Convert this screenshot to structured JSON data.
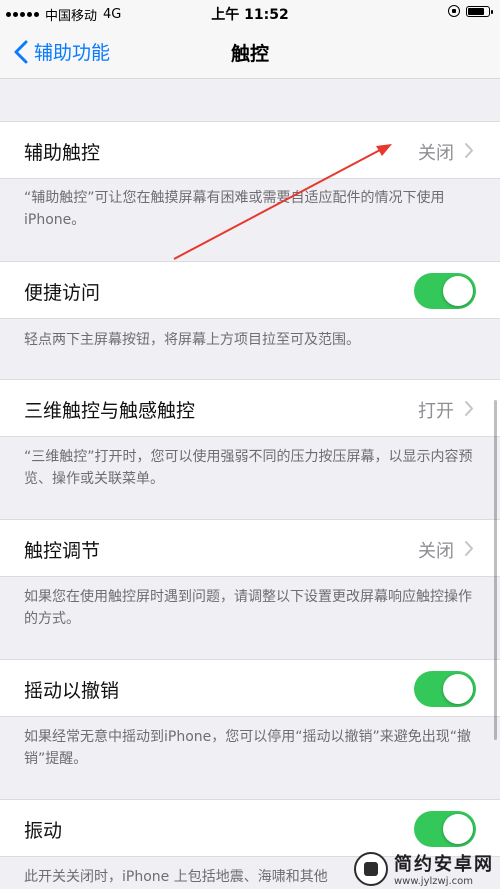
{
  "status_bar": {
    "carrier": "中国移动",
    "network": "4G",
    "time": "上午 11:52"
  },
  "nav": {
    "back_label": "辅助功能",
    "title": "触控"
  },
  "rows": [
    {
      "label": "辅助触控",
      "value": "关闭",
      "type": "disclosure"
    },
    {
      "label": "便捷访问",
      "type": "toggle",
      "on": true
    },
    {
      "label": "三维触控与触感触控",
      "value": "打开",
      "type": "disclosure"
    },
    {
      "label": "触控调节",
      "value": "关闭",
      "type": "disclosure"
    },
    {
      "label": "摇动以撤销",
      "type": "toggle",
      "on": true
    },
    {
      "label": "振动",
      "type": "toggle",
      "on": true
    }
  ],
  "footers": [
    "“辅助触控”可让您在触摸屏幕有困难或需要自适应配件的情况下使用 iPhone。",
    "轻点两下主屏幕按钮，将屏幕上方项目拉至可及范围。",
    "“三维触控”打开时，您可以使用强弱不同的压力按压屏幕，以显示内容预览、操作或关联菜单。",
    "如果您在使用触控屏时遇到问题，请调整以下设置更改屏幕响应触控操作的方式。",
    "如果经常无意中摇动到iPhone，您可以停用“摇动以撤销”来避免出现“撤销”提醒。",
    "此开关关闭时，iPhone 上包括地震、海啸和其他"
  ],
  "watermark": {
    "title": "简约安卓网",
    "url": "www.jylzwj.com"
  },
  "colors": {
    "accent": "#0a7aff",
    "toggle_on": "#34c759",
    "annotation_arrow": "#e8382d"
  },
  "icons": [
    "chevron-left-icon",
    "chevron-right-icon",
    "signal-icon",
    "orientation-lock-icon",
    "battery-icon"
  ]
}
